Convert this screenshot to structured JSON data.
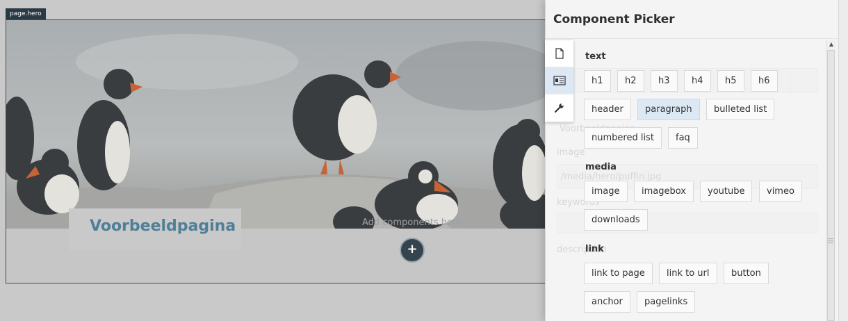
{
  "hero": {
    "tag": "page.hero",
    "title": "Voorbeeldpagina",
    "add_hint": "Add components here",
    "add_symbol": "+"
  },
  "ghost_form": {
    "title_value": "Voorbeeldpagina",
    "image_label": "image",
    "image_path": "/media/hero/puffin.jpg",
    "keywords_label": "keywords",
    "description_label": "description"
  },
  "panel": {
    "title": "Component Picker",
    "tabs": [
      {
        "name": "page",
        "icon": "document-icon",
        "active": false
      },
      {
        "name": "components",
        "icon": "id-card-icon",
        "active": true
      },
      {
        "name": "settings",
        "icon": "wrench-icon",
        "active": false
      }
    ],
    "categories": [
      {
        "label": "text",
        "items": [
          "h1",
          "h2",
          "h3",
          "h4",
          "h5",
          "h6",
          "header",
          "paragraph",
          "bulleted list",
          "numbered list",
          "faq"
        ],
        "active": "paragraph"
      },
      {
        "label": "media",
        "items": [
          "image",
          "imagebox",
          "youtube",
          "vimeo",
          "downloads"
        ]
      },
      {
        "label": "link",
        "items": [
          "link to page",
          "link to url",
          "button",
          "anchor",
          "pagelinks"
        ]
      }
    ]
  },
  "colors": {
    "accent": "#4f7f98",
    "active_chip": "#dce9f4",
    "dark": "#35454f"
  }
}
